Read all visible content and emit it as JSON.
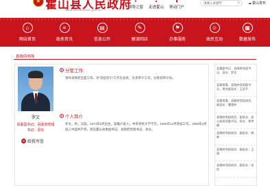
{
  "header": {
    "site_title": "霍山县人民政府",
    "site_url": "www.ahhuoshan.gov.cn",
    "links": [
      {
        "label": "领导之窗",
        "icon": "user-icon"
      },
      {
        "label": "走进霍山",
        "icon": "building-icon"
      },
      {
        "label": "移动门户",
        "icon": "mobile-icon"
      }
    ],
    "search_placeholder": "请输入关键字",
    "weather": "霍山发布"
  },
  "nav": [
    {
      "label": "网站首页",
      "icon": "home-icon"
    },
    {
      "label": "政务资讯",
      "icon": "news-icon"
    },
    {
      "label": "信息公开",
      "icon": "info-icon"
    },
    {
      "label": "解读回应",
      "icon": "interpret-icon"
    },
    {
      "label": "办事服务",
      "icon": "service-icon"
    },
    {
      "label": "政民互动",
      "icon": "interaction-icon"
    },
    {
      "label": "数据发布",
      "icon": "data-icon"
    }
  ],
  "breadcrumb": "县政府领导",
  "profile": {
    "name": "罗文",
    "title": "县委副书记、县政府党组书记、县长",
    "mailbox_label": "给我写信",
    "duties_heading": "分管工作",
    "duties_text": "领导县政府全面工作。对“双招双引”工作负总责，负责审计工作。分管县审计局。",
    "bio_heading": "个人简介",
    "bio_text": "罗文，男，汉族，1974年6月出生，安徽六安人，中央党校大学学历，1995年12月参加工作，1999年6月加入中国共产党，现任霍山县委副书记、县政府党组书记、县长。"
  },
  "leaders": [
    "县委副书记、县政府党组书记、县长：罗文",
    "县委常委、县政府党组副书记、常务副县长：王远平",
    "县委常委、县政府党组成员、副县长：曹国伟",
    "县政府党组成员、副县长、县公安局党委书记、局长：郑传献",
    "县政府党组成员、副县长：姚新",
    "县政府党组成员、副县长：王翔",
    "县政府党组成员、副县长：张红"
  ]
}
